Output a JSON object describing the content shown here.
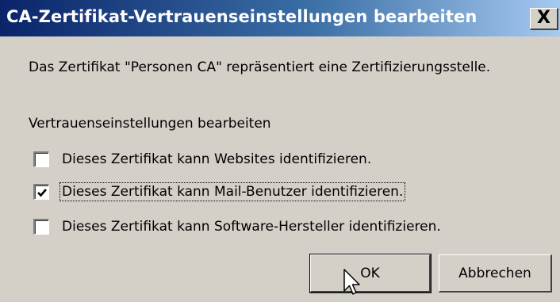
{
  "window": {
    "title": "CA-Zertifikat-Vertrauenseinstellungen bearbeiten",
    "close_label": "X"
  },
  "dialog": {
    "statement": "Das Zertifikat \"Personen CA\" repräsentiert eine Zertifizierungsstelle.",
    "section_label": "Vertrauenseinstellungen bearbeiten",
    "options": [
      {
        "label": "Dieses Zertifikat kann Websites identifizieren.",
        "checked": false
      },
      {
        "label": "Dieses Zertifikat kann Mail-Benutzer identifizieren.",
        "checked": true
      },
      {
        "label": "Dieses Zertifikat kann Software-Hersteller identifizieren.",
        "checked": false
      }
    ],
    "buttons": {
      "ok": "OK",
      "cancel": "Abbrechen"
    }
  },
  "colors": {
    "title_gradient_start": "#0a246a",
    "title_gradient_end": "#a6caf0",
    "dialog_background": "#d4d0c8"
  },
  "icons": [
    "close-icon",
    "checkmark-icon",
    "mouse-pointer-icon"
  ]
}
